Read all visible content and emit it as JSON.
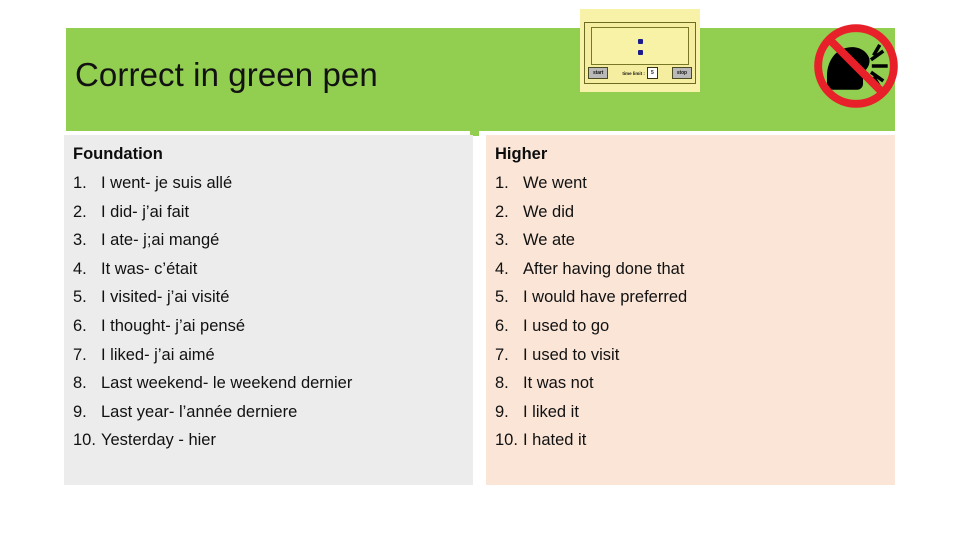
{
  "slide": {
    "title": "Correct in green pen",
    "accent_green": "#92ce4f",
    "foundation_bg": "#ececec",
    "higher_bg": "#fae5d7",
    "sign_red": "#e8202a",
    "timer_yellow": "#f7f2a8"
  },
  "timer": {
    "start_label": "start",
    "limit_label": "time limit :",
    "limit_value": "5",
    "stop_label": "stop",
    "display_value": ":"
  },
  "sign": {
    "name": "no-talking-sign",
    "meaning": "no talking"
  },
  "foundation": {
    "heading": "Foundation",
    "items": [
      {
        "num": "1.",
        "text": "I went- je suis allé"
      },
      {
        "num": "2.",
        "text": "I did- j’ai fait"
      },
      {
        "num": "3.",
        "text": "I ate- j;ai mangé"
      },
      {
        "num": "4.",
        "text": "It was- c’était"
      },
      {
        "num": "5.",
        "text": "I visited- j’ai visité"
      },
      {
        "num": "6.",
        "text": "I thought- j’ai pensé"
      },
      {
        "num": "7.",
        "text": "I liked- j’ai aimé"
      },
      {
        "num": "8.",
        "text": "Last weekend- le weekend dernier"
      },
      {
        "num": "9.",
        "text": "Last year- l’année derniere"
      },
      {
        "num": "10.",
        "text": "Yesterday - hier"
      }
    ]
  },
  "higher": {
    "heading": "Higher",
    "items": [
      {
        "num": "1.",
        "text": "We went"
      },
      {
        "num": "2.",
        "text": "We did"
      },
      {
        "num": "3.",
        "text": "We ate"
      },
      {
        "num": "4.",
        "text": "After having done that"
      },
      {
        "num": "5.",
        "text": "I would have preferred"
      },
      {
        "num": "6.",
        "text": "I used to go"
      },
      {
        "num": "7.",
        "text": "I used to visit"
      },
      {
        "num": "8.",
        "text": "It was not"
      },
      {
        "num": "9.",
        "text": "I liked it"
      },
      {
        "num": "10.",
        "text": "I hated it"
      }
    ]
  }
}
